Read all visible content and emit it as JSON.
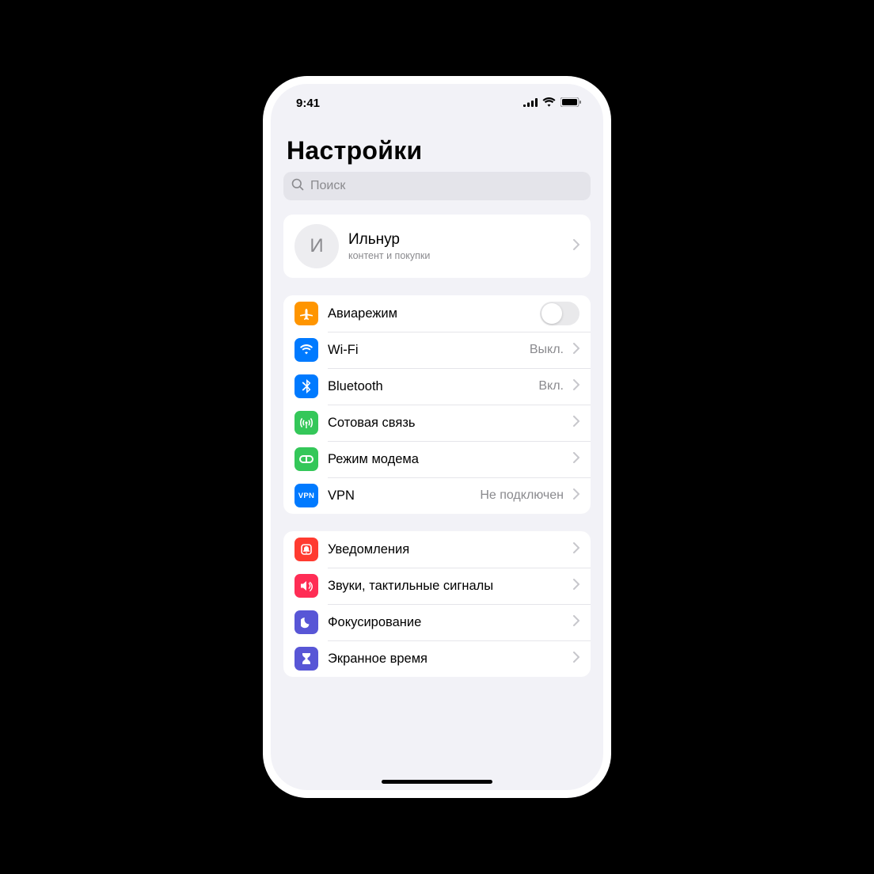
{
  "status": {
    "time": "9:41"
  },
  "page": {
    "title": "Настройки"
  },
  "search": {
    "placeholder": "Поиск"
  },
  "profile": {
    "initial": "И",
    "name": "Ильнур",
    "subtitle": "контент и покупки"
  },
  "groups": [
    {
      "rows": [
        {
          "key": "airplane",
          "label": "Авиарежим",
          "iconColor": "#ff9500",
          "toggle": false
        },
        {
          "key": "wifi",
          "label": "Wi-Fi",
          "value": "Выкл.",
          "iconColor": "#007aff"
        },
        {
          "key": "bluetooth",
          "label": "Bluetooth",
          "value": "Вкл.",
          "iconColor": "#007aff"
        },
        {
          "key": "cellular",
          "label": "Сотовая связь",
          "iconColor": "#34c759"
        },
        {
          "key": "hotspot",
          "label": "Режим модема",
          "iconColor": "#34c759"
        },
        {
          "key": "vpn",
          "label": "VPN",
          "value": "Не подключен",
          "iconColor": "#007aff",
          "iconText": "VPN"
        }
      ]
    },
    {
      "rows": [
        {
          "key": "notifications",
          "label": "Уведомления",
          "iconColor": "#ff3b30"
        },
        {
          "key": "sounds",
          "label": "Звуки, тактильные сигналы",
          "iconColor": "#ff2d55"
        },
        {
          "key": "focus",
          "label": "Фокусирование",
          "iconColor": "#5856d6"
        },
        {
          "key": "screentime",
          "label": "Экранное время",
          "iconColor": "#5856d6"
        }
      ]
    }
  ]
}
